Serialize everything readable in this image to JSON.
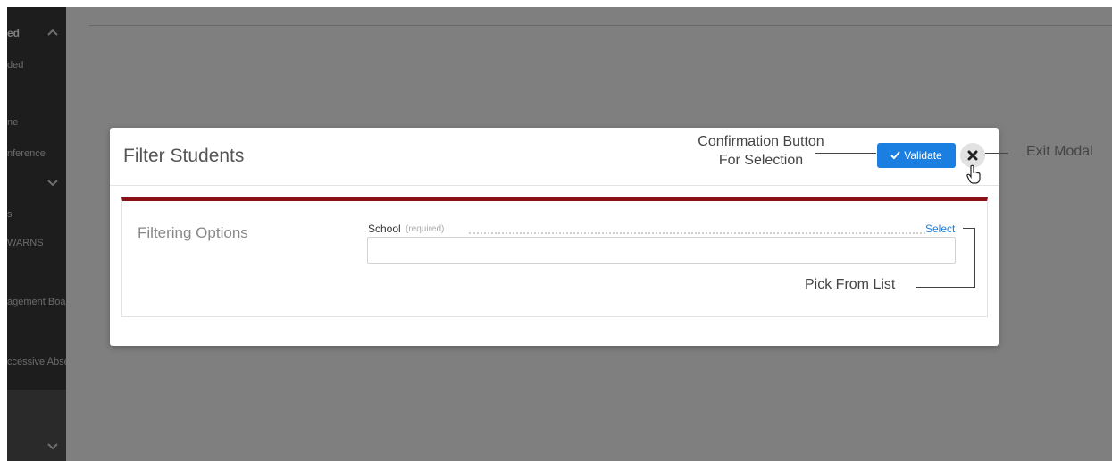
{
  "sidebar": {
    "section_header": "ed",
    "items": [
      "ded",
      "ne",
      "nference",
      "s",
      "WARNS",
      "agement Boa",
      "ccessive Abse"
    ]
  },
  "modal": {
    "title": "Filter Students",
    "validate_label": "Validate",
    "panel_label": "Filtering Options",
    "field_label": "School",
    "field_required": "(required)",
    "select_link": "Select",
    "input_value": ""
  },
  "annotations": {
    "confirm_line1": "Confirmation Button",
    "confirm_line2": "For Selection",
    "exit": "Exit Modal",
    "pick": "Pick From List"
  },
  "colors": {
    "accent_blue": "#1a7fe0",
    "panel_top_border": "#8c1015",
    "sidebar_bg": "#3a3a3a"
  },
  "icons": [
    "chevron-up-icon",
    "chevron-down-icon",
    "check-icon",
    "close-icon",
    "hand-pointer-icon"
  ]
}
